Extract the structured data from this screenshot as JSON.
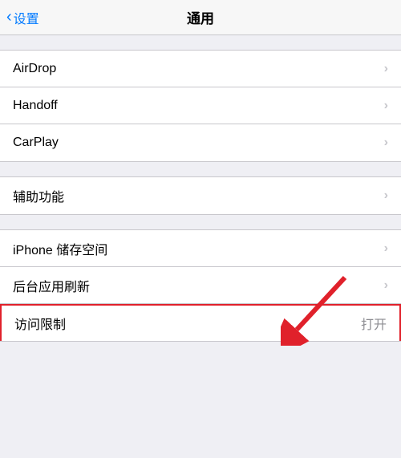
{
  "nav": {
    "back_label": "设置",
    "title": "通用"
  },
  "groups": [
    {
      "id": "group1",
      "rows": [
        {
          "id": "airdrop",
          "label": "AirDrop",
          "value": "",
          "hasChevron": true
        },
        {
          "id": "handoff",
          "label": "Handoff",
          "value": "",
          "hasChevron": true
        },
        {
          "id": "carplay",
          "label": "CarPlay",
          "value": "",
          "hasChevron": true
        }
      ]
    },
    {
      "id": "group2",
      "rows": [
        {
          "id": "accessibility",
          "label": "辅助功能",
          "value": "",
          "hasChevron": true
        }
      ]
    },
    {
      "id": "group3",
      "rows": [
        {
          "id": "iphone-storage",
          "label": "iPhone 储存空间",
          "value": "",
          "hasChevron": true
        },
        {
          "id": "background-refresh",
          "label": "后台应用刷新",
          "value": "",
          "hasChevron": true
        },
        {
          "id": "restrictions",
          "label": "访问限制",
          "value": "打开",
          "hasChevron": false,
          "highlighted": true
        }
      ]
    }
  ],
  "colors": {
    "accent": "#007aff",
    "red": "#e0212b",
    "chevron": "#c7c7cc",
    "value_text": "#8e8e93"
  }
}
